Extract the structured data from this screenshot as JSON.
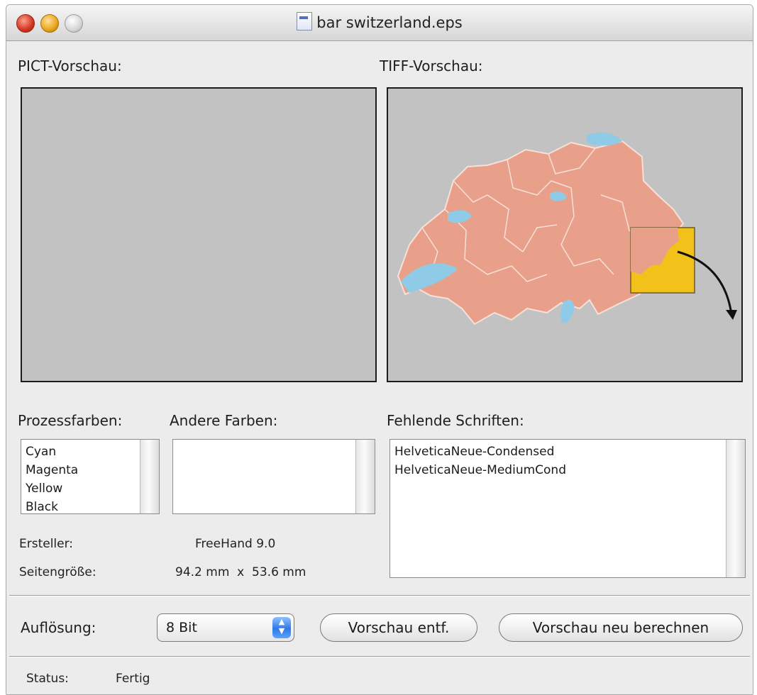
{
  "window": {
    "title": "bar switzerland.eps"
  },
  "labels": {
    "pict_preview": "PICT-Vorschau:",
    "tiff_preview": "TIFF-Vorschau:",
    "process_colors": "Prozessfarben:",
    "other_colors": "Andere Farben:",
    "missing_fonts": "Fehlende Schriften:",
    "creator": "Ersteller:",
    "page_size": "Seitengröße:",
    "resolution": "Auflösung:",
    "status": "Status:"
  },
  "process_colors": [
    "Cyan",
    "Magenta",
    "Yellow",
    "Black"
  ],
  "other_colors": [],
  "missing_fonts": [
    "HelveticaNeue-Condensed",
    "HelveticaNeue-MediumCond"
  ],
  "values": {
    "creator": "FreeHand 9.0",
    "page_size": "94.2 mm  x  53.6 mm",
    "status": "Fertig"
  },
  "controls": {
    "resolution_selected": "8 Bit",
    "remove_preview_button": "Vorschau entf.",
    "recalculate_preview_button": "Vorschau neu berechnen"
  },
  "colors": {
    "preview_bg": "#c2c2c2",
    "map_fill": "#e9a08b",
    "lake": "#8fcbe6",
    "highlight": "#f2c21a"
  }
}
